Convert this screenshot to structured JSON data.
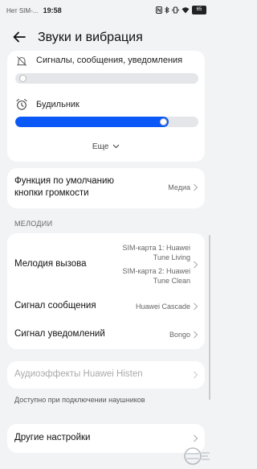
{
  "status_bar": {
    "carrier": "Нет SIM-...",
    "time": "19:58",
    "battery": "65"
  },
  "header": {
    "title": "Звуки и вибрация"
  },
  "volume": {
    "notifications": {
      "label": "Сигналы, сообщения, уведомления",
      "level": 0.02
    },
    "alarm": {
      "label": "Будильник",
      "level": 0.79
    },
    "more_label": "Еще"
  },
  "volume_button": {
    "title": "Функция по умолчанию кнопки громкости",
    "value": "Медиа"
  },
  "ringtones": {
    "section_label": "МЕЛОДИИ",
    "ringtone": {
      "title": "Мелодия вызова",
      "sim1": "SIM-карта 1: Huawei Tune Living",
      "sim2": "SIM-карта 2: Huawei Tune Clean"
    },
    "message": {
      "title": "Сигнал сообщения",
      "value": "Huawei Cascade"
    },
    "notification": {
      "title": "Сигнал уведомлений",
      "value": "Bongo"
    }
  },
  "histen": {
    "title": "Аудиоэффекты Huawei Histen",
    "note": "Доступно при подключении наушников"
  },
  "other": {
    "title": "Другие настройки"
  },
  "accent_color": "#0a59f7"
}
